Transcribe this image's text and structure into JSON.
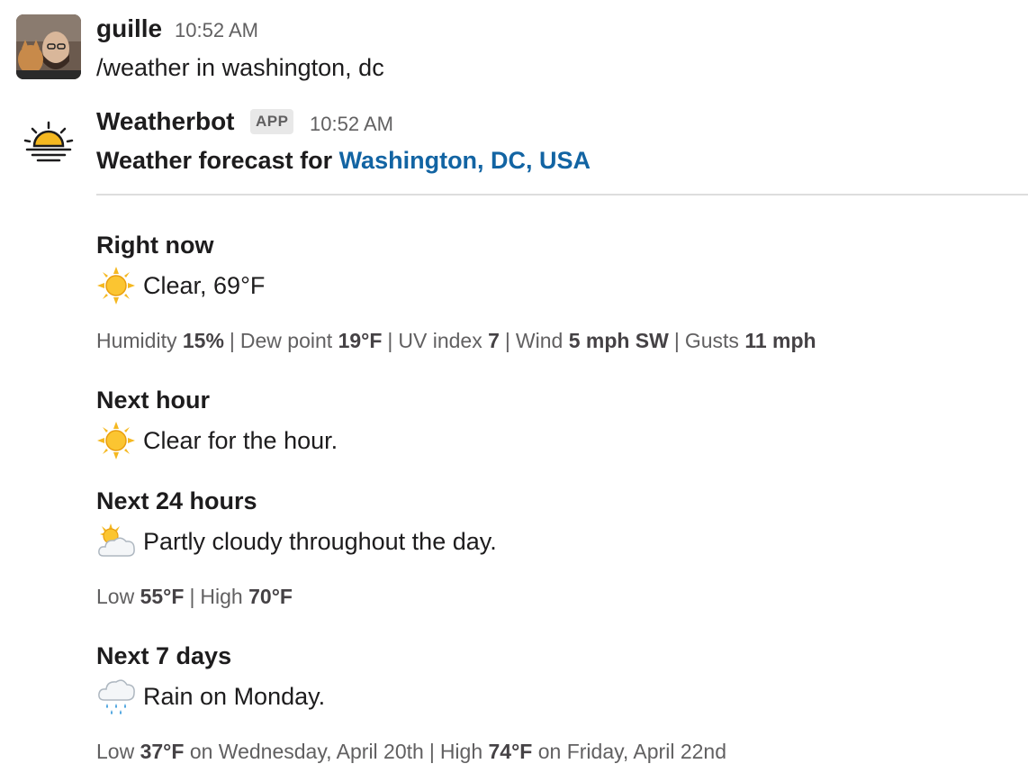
{
  "messages": [
    {
      "user": "guille",
      "time": "10:52 AM",
      "text": "/weather in washington, dc"
    }
  ],
  "bot": {
    "name": "Weatherbot",
    "badge": "APP",
    "time": "10:52 AM",
    "intro": "Weather forecast for ",
    "location_link": "Washington, DC, USA"
  },
  "sections": {
    "now": {
      "title": "Right now",
      "icon": "sun-icon",
      "summary": "Clear, 69°F",
      "details": [
        {
          "label": "Humidity",
          "value": "15%"
        },
        {
          "label": "Dew point",
          "value": "19°F"
        },
        {
          "label": "UV index",
          "value": "7"
        },
        {
          "label": "Wind",
          "value": "5 mph SW"
        },
        {
          "label": "Gusts",
          "value": "11 mph"
        }
      ]
    },
    "hour": {
      "title": "Next hour",
      "icon": "sun-icon",
      "summary": "Clear for the hour."
    },
    "day": {
      "title": "Next 24 hours",
      "icon": "sun-behind-cloud-icon",
      "summary": "Partly cloudy throughout the day.",
      "low_label": "Low",
      "low": "55°F",
      "high_label": "High",
      "high": "70°F"
    },
    "week": {
      "title": "Next 7 days",
      "icon": "rain-cloud-icon",
      "summary": "Rain on Monday.",
      "low_label": "Low",
      "low": "37°F",
      "low_when": "on Wednesday, April 20th",
      "high_label": "High",
      "high": "74°F",
      "high_when": "on Friday, April 22nd"
    }
  },
  "colors": {
    "link": "#1264a3",
    "muted": "#616061",
    "sun": "#f5b820"
  }
}
